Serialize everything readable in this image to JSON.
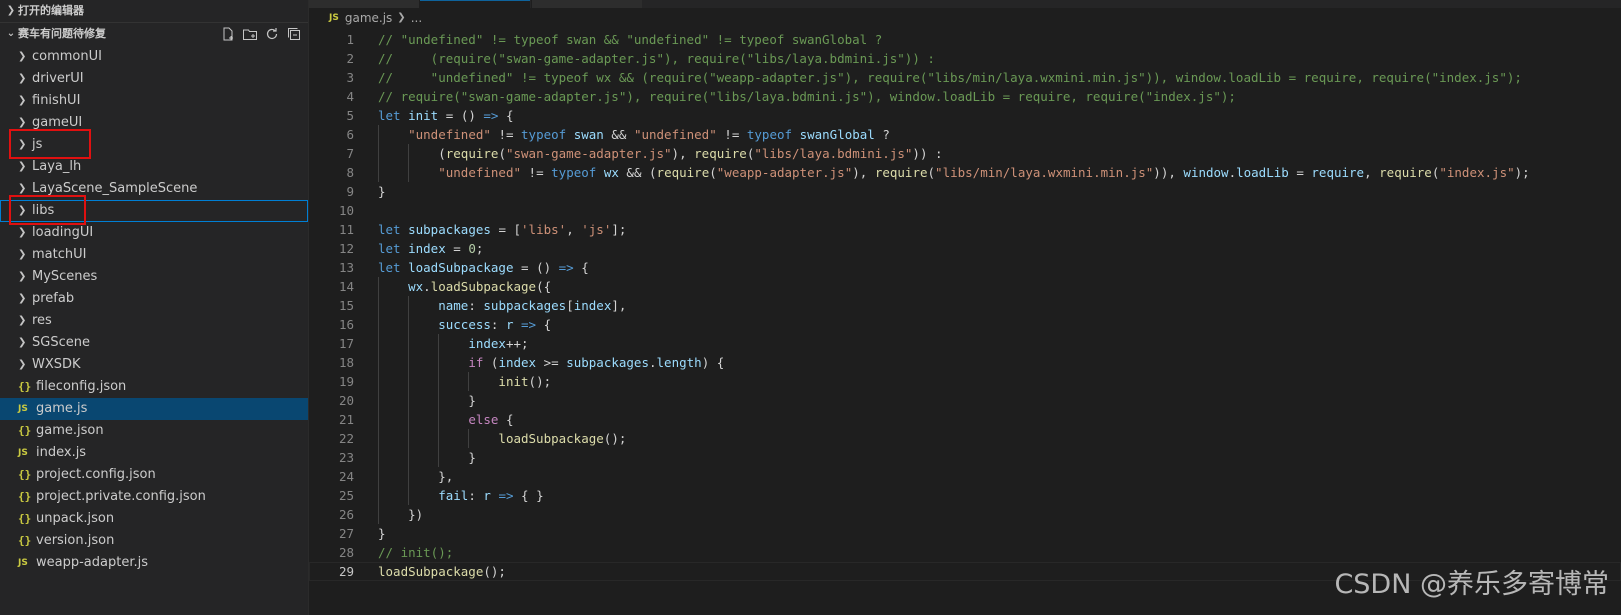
{
  "explorer": {
    "open_editors_label": "打开的编辑器",
    "project_label": "赛车有问题待修复",
    "actions": [
      "new-file-icon",
      "new-folder-icon",
      "refresh-icon",
      "collapse-all-icon"
    ],
    "items": [
      {
        "label": "commonUI",
        "type": "folder"
      },
      {
        "label": "driverUI",
        "type": "folder"
      },
      {
        "label": "finishUI",
        "type": "folder"
      },
      {
        "label": "gameUI",
        "type": "folder"
      },
      {
        "label": "js",
        "type": "folder"
      },
      {
        "label": "Laya_lh",
        "type": "folder"
      },
      {
        "label": "LayaScene_SampleScene",
        "type": "folder"
      },
      {
        "label": "libs",
        "type": "folder"
      },
      {
        "label": "loadingUI",
        "type": "folder"
      },
      {
        "label": "matchUI",
        "type": "folder"
      },
      {
        "label": "MyScenes",
        "type": "folder"
      },
      {
        "label": "prefab",
        "type": "folder"
      },
      {
        "label": "res",
        "type": "folder"
      },
      {
        "label": "SGScene",
        "type": "folder"
      },
      {
        "label": "WXSDK",
        "type": "folder"
      },
      {
        "label": "fileconfig.json",
        "type": "json"
      },
      {
        "label": "game.js",
        "type": "js"
      },
      {
        "label": "game.json",
        "type": "json"
      },
      {
        "label": "index.js",
        "type": "js"
      },
      {
        "label": "project.config.json",
        "type": "json"
      },
      {
        "label": "project.private.config.json",
        "type": "json"
      },
      {
        "label": "unpack.json",
        "type": "json"
      },
      {
        "label": "version.json",
        "type": "json"
      },
      {
        "label": "weapp-adapter.js",
        "type": "js"
      }
    ],
    "selected_item": "game.js",
    "focused_item": "libs",
    "highlighted_items": [
      "js",
      "libs"
    ],
    "js_badge": "JS",
    "json_badge": "{}"
  },
  "breadcrumb": {
    "file": "game.js",
    "more": "..."
  },
  "editor": {
    "current_line": 29,
    "lines": [
      "// \"undefined\" != typeof swan && \"undefined\" != typeof swanGlobal ?",
      "//     (require(\"swan-game-adapter.js\"), require(\"libs/laya.bdmini.js\")) :",
      "//     \"undefined\" != typeof wx && (require(\"weapp-adapter.js\"), require(\"libs/min/laya.wxmini.min.js\")), window.loadLib = require, require(\"index.js\");",
      "// require(\"swan-game-adapter.js\"), require(\"libs/laya.bdmini.js\"), window.loadLib = require, require(\"index.js\");",
      "let init = () => {",
      "    \"undefined\" != typeof swan && \"undefined\" != typeof swanGlobal ?",
      "        (require(\"swan-game-adapter.js\"), require(\"libs/laya.bdmini.js\")) :",
      "        \"undefined\" != typeof wx && (require(\"weapp-adapter.js\"), require(\"libs/min/laya.wxmini.min.js\")), window.loadLib = require, require(\"index.js\");",
      "}",
      "",
      "let subpackages = ['libs', 'js'];",
      "let index = 0;",
      "let loadSubpackage = () => {",
      "    wx.loadSubpackage({",
      "        name: subpackages[index],",
      "        success: r => {",
      "            index++;",
      "            if (index >= subpackages.length) {",
      "                init();",
      "            }",
      "            else {",
      "                loadSubpackage();",
      "            }",
      "        },",
      "        fail: r => { }",
      "    })",
      "}",
      "// init();",
      "loadSubpackage();"
    ]
  },
  "watermark": "CSDN @养乐多寄博常",
  "colors": {
    "background": "#1e1e1e",
    "sidebar": "#252526",
    "selection": "#094771",
    "annotation_red": "#e01010",
    "comment": "#6a9955",
    "keyword": "#569cd6",
    "string": "#ce9178",
    "variable": "#9cdcfe",
    "function": "#dcdcaa"
  }
}
